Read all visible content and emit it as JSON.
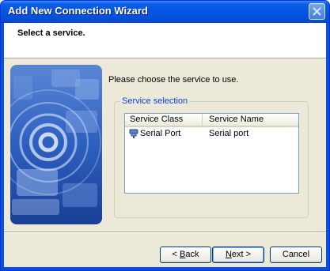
{
  "window": {
    "title": "Add New Connection Wizard",
    "close_icon": "close-icon"
  },
  "header": {
    "title": "Select a service."
  },
  "main": {
    "prompt": "Please choose the service to use.",
    "group_label": "Service selection",
    "list": {
      "columns": [
        "Service Class",
        "Service Name"
      ],
      "rows": [
        {
          "icon": "serial-port-icon",
          "service_class": "Serial Port",
          "service_name": "Serial port"
        }
      ]
    }
  },
  "buttons": {
    "back_prefix": "<",
    "back_mnemonic": "B",
    "back_rest": "ack",
    "next_mnemonic": "N",
    "next_rest": "ext >",
    "cancel": "Cancel"
  },
  "colors": {
    "titlebar": "#0554e3",
    "dialog_face": "#ece9d8",
    "group_label": "#0046d5",
    "art_blue": "#1f4fa8"
  }
}
